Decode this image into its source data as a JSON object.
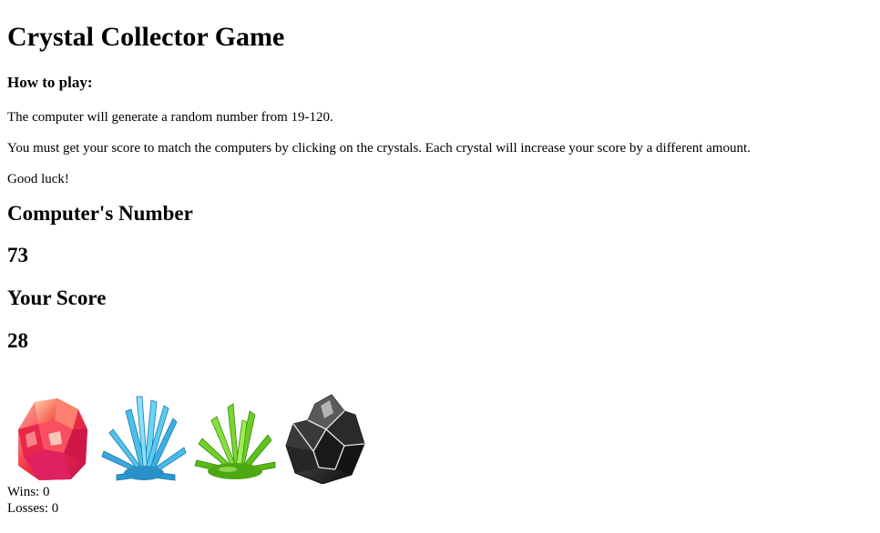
{
  "page": {
    "title": "Crystal Collector Game",
    "how_to_heading": "How to play:",
    "instructions": [
      "The computer will generate a random number from 19-120.",
      "You must get your score to match the computers by clicking on the crystals. Each crystal will increase your score by a different amount.",
      "Good luck!"
    ]
  },
  "game": {
    "computer_label": "Computer's Number",
    "computer_number": "73",
    "score_label": "Your Score",
    "score_value": "28",
    "wins_label": "Wins:",
    "wins_value": "0",
    "losses_label": "Losses:",
    "losses_value": "0"
  },
  "crystals": [
    {
      "name": "red-crystal",
      "color": "#e8364a"
    },
    {
      "name": "blue-crystal",
      "color": "#2fa8d8"
    },
    {
      "name": "green-crystal",
      "color": "#5cc21a"
    },
    {
      "name": "black-crystal",
      "color": "#2a2a2a"
    }
  ]
}
